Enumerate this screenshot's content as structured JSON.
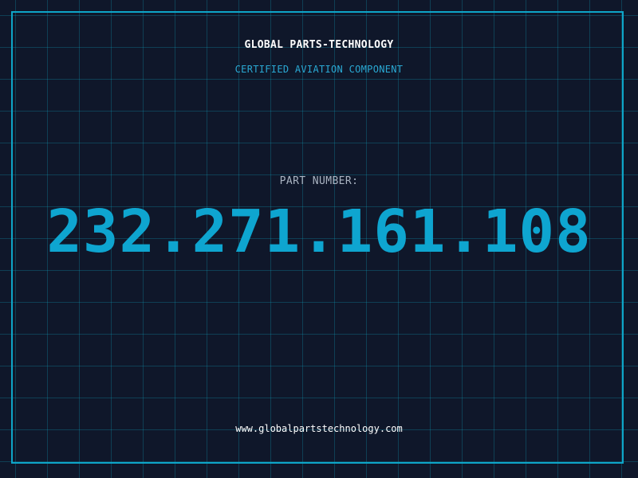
{
  "header": {
    "company": "GLOBAL PARTS-TECHNOLOGY",
    "subtitle": "CERTIFIED AVIATION COMPONENT"
  },
  "part": {
    "label": "PART NUMBER:",
    "number": "232.271.161.108"
  },
  "footer": {
    "website": "www.globalpartstechnology.com"
  },
  "colors": {
    "background": "#0f172a",
    "accent": "#0ea5d0",
    "grid": "#0ea5c4",
    "label": "#aab4c2",
    "text": "#ffffff"
  }
}
